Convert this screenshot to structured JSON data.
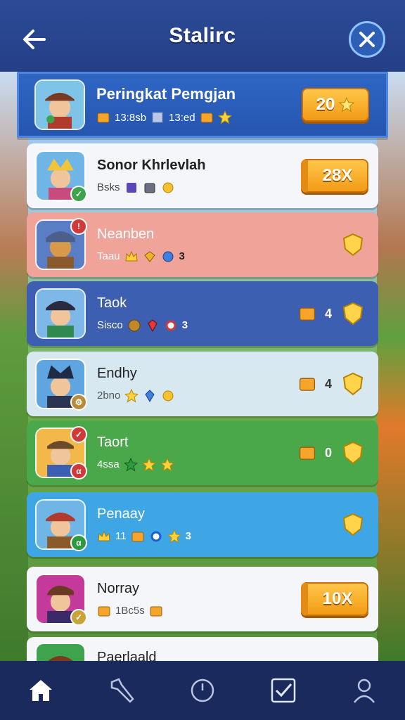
{
  "header": {
    "title": "Stalirc"
  },
  "icons": {
    "back": "arrow-left-icon",
    "close": "close-icon"
  },
  "colors": {
    "header": "#2c4b97",
    "accent_gold": "#f4a52a",
    "highlight_row": "#2f66c4"
  },
  "top_player": {
    "name": "Peringkat Pemgjan",
    "stat1": "13:8sb",
    "stat2": "13:ed",
    "reward": "20"
  },
  "rows": [
    {
      "name": "Sonor Khrlevlah",
      "stats_text": "Bsks",
      "reward": "28X"
    },
    {
      "name": "Neanben",
      "stats_text": "Taau",
      "count": "3"
    },
    {
      "name": "Taok",
      "stats_text": "Sisco",
      "count": "3",
      "right_count": "4"
    },
    {
      "name": "Endhy",
      "stats_text": "2bno",
      "right_count": "4"
    },
    {
      "name": "Taort",
      "stats_text": "4ssa",
      "right_count": "0"
    },
    {
      "name": "Penaay",
      "stats_text": "11",
      "count": "3"
    },
    {
      "name": "Norray",
      "stats_text": "1Bc5s",
      "reward": "10X"
    },
    {
      "name": "Paerlaald"
    }
  ],
  "tabs": [
    "home-icon",
    "tools-icon",
    "timer-icon",
    "checkbox-icon",
    "profile-icon"
  ]
}
